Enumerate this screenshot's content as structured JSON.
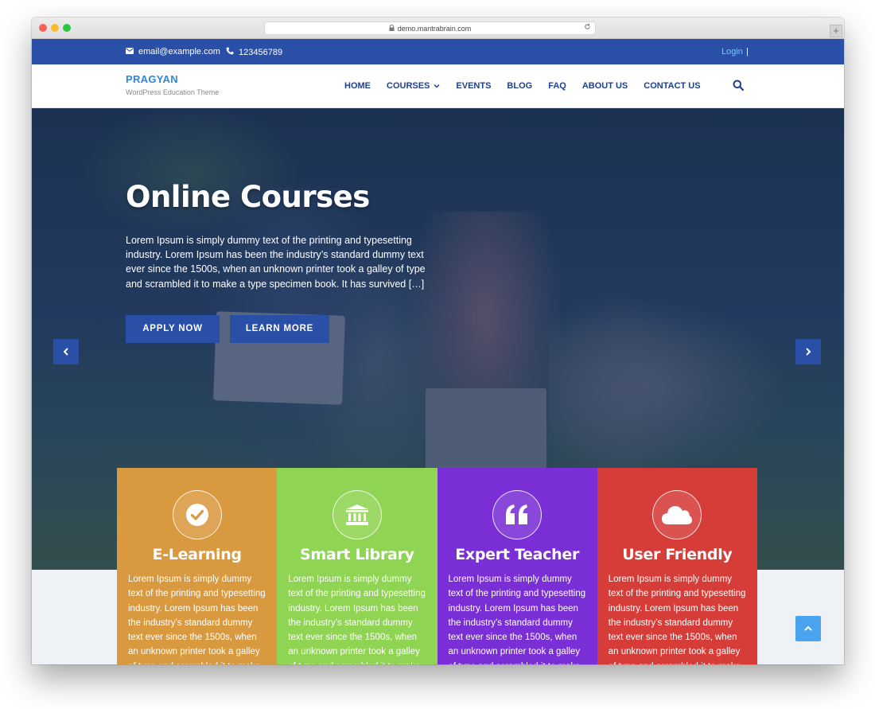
{
  "browser": {
    "url": "demo.mantrabrain.com",
    "new_tab_label": "+"
  },
  "topbar": {
    "email": "email@example.com",
    "phone": "123456789",
    "login": "Login",
    "separator": "|"
  },
  "brand": {
    "name": "PRAGYAN",
    "tagline": "WordPress Education Theme"
  },
  "nav": {
    "items": [
      "HOME",
      "COURSES",
      "EVENTS",
      "BLOG",
      "FAQ",
      "ABOUT US",
      "CONTACT US"
    ]
  },
  "hero": {
    "title": "Online Courses",
    "text": "Lorem Ipsum is simply dummy text of the printing and typesetting industry. Lorem Ipsum has been the industry’s standard dummy text ever since the 1500s, when an unknown printer took a galley of type and scrambled it to make a type specimen book. It has survived […]",
    "apply_label": "APPLY NOW",
    "learn_label": "LEARN MORE"
  },
  "features": [
    {
      "title": "E-Learning",
      "icon": "check-circle-icon",
      "color": "#d9993e",
      "text": "Lorem Ipsum is simply dummy text of the printing and typesetting industry. Lorem Ipsum has been the industry’s standard dummy text ever since the 1500s, when an unknown printer took a galley of type and scrambled it to make a type specimen book."
    },
    {
      "title": "Smart Library",
      "icon": "bank-icon",
      "color": "#8fd453",
      "text": "Lorem Ipsum is simply dummy text of the printing and typesetting industry. Lorem Ipsum has been the industry’s standard dummy text ever since the 1500s, when an unknown printer took a galley of type and scrambled it to make a type specimen book."
    },
    {
      "title": "Expert Teacher",
      "icon": "quote-icon",
      "color": "#7a2fd6",
      "text": "Lorem Ipsum is simply dummy text of the printing and typesetting industry. Lorem Ipsum has been the industry’s standard dummy text ever since the 1500s, when an unknown printer took a galley of type and scrambled it to make a type specimen book."
    },
    {
      "title": "User Friendly",
      "icon": "cloud-icon",
      "color": "#d63c38",
      "text": "Lorem Ipsum is simply dummy text of the printing and typesetting industry. Lorem Ipsum has been the industry’s standard dummy text ever since the 1500s, when an unknown printer took a galley of type and scrambled it to make a type specimen book."
    }
  ],
  "colors": {
    "primary": "#2a4fa6",
    "brand_text": "#2e86de",
    "nav_text": "#1d3f8f",
    "scroll_top": "#4aa3ef"
  }
}
